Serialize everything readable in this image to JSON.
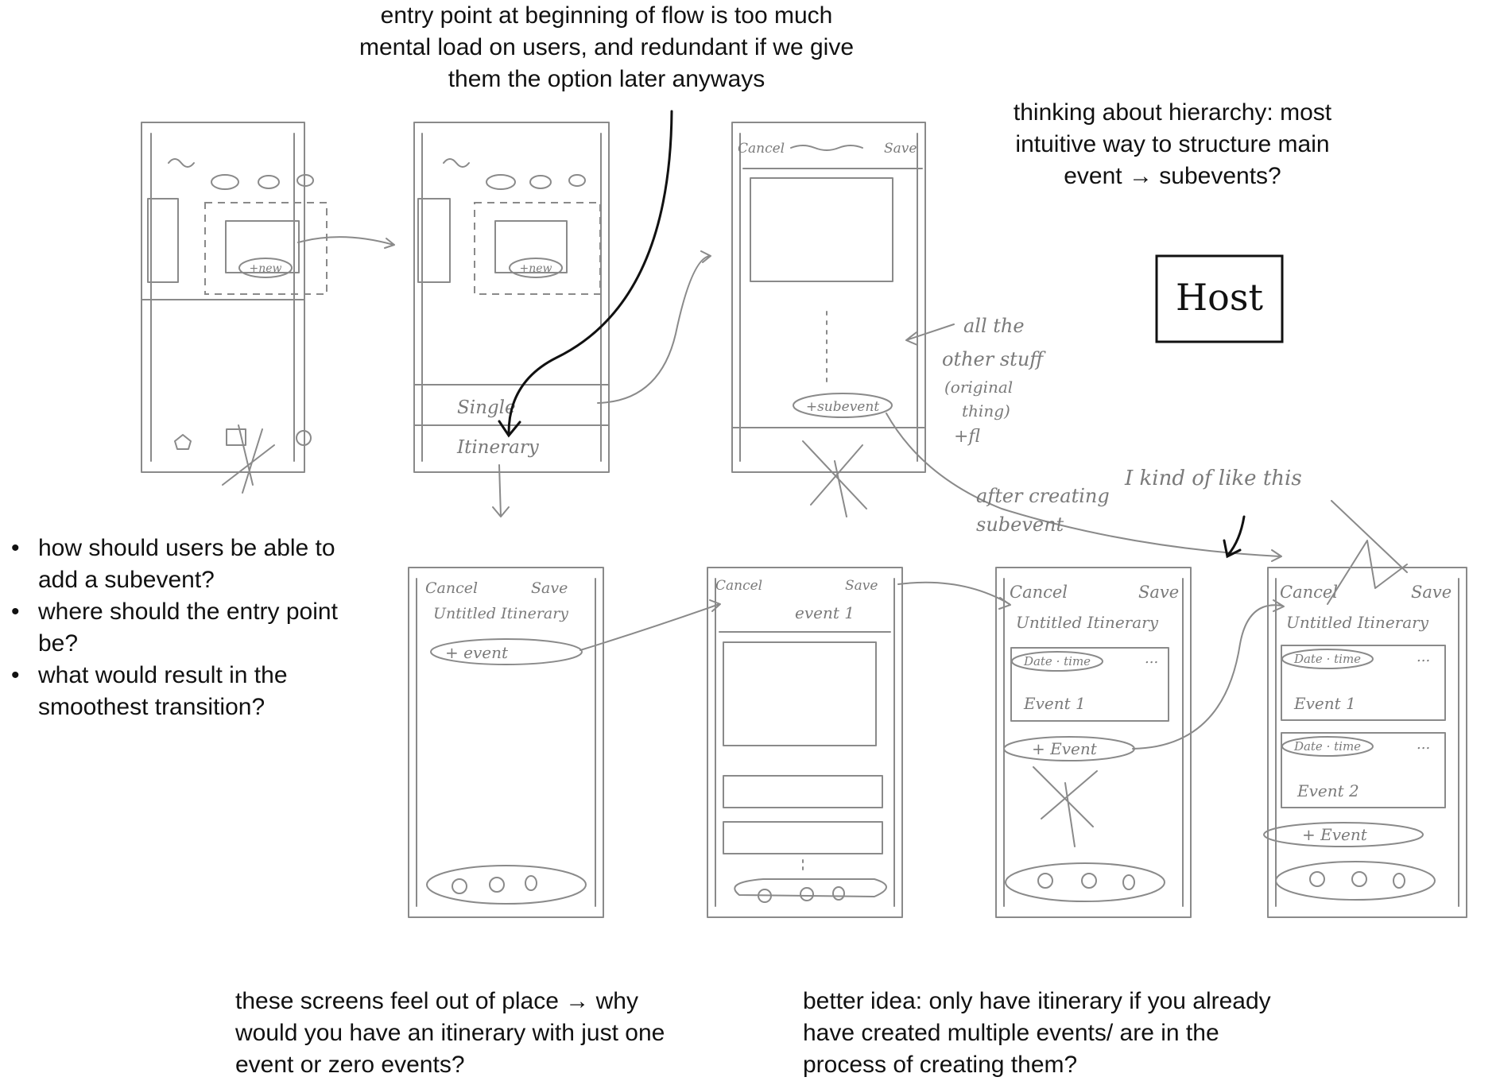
{
  "notes": {
    "entry_point": "entry point at beginning of flow is too much mental load on users, and redundant if we give them the option later anyways",
    "hierarchy": "thinking about hierarchy: most intuitive way to structure main event → subevents?",
    "screens_out_of_place": "these screens feel out of place → why would you have an itinerary with just one event or zero events?",
    "better_idea": "better idea: only have itinerary if you already have created multiple events/ are in the process of creating them?"
  },
  "questions": [
    "how should users be able to add a subevent?",
    "where should the entry point be?",
    "what would result in the smoothest transition?"
  ],
  "sketch_labels": {
    "new": "+new",
    "single": "Single",
    "itinerary": "Itinerary",
    "cancel": "Cancel",
    "save": "Save",
    "subevent": "+subevent",
    "all_the_other_stuff": "all the other stuff (original thing) +fl",
    "after_creating_subevent": "after creating subevent",
    "i_kind_of_like_this": "I kind of like this",
    "host": "Host",
    "untitled_itinerary": "Untitled Itinerary",
    "add_event_lower": "+ event",
    "add_event": "+ Event",
    "event_1": "event 1",
    "event_1_cap": "Event 1",
    "event_2": "Event 2",
    "date_time": "Date · time",
    "more": "..."
  },
  "colors": {
    "text": "#111111",
    "sketch": "#8a8a8a",
    "background": "#ffffff"
  }
}
